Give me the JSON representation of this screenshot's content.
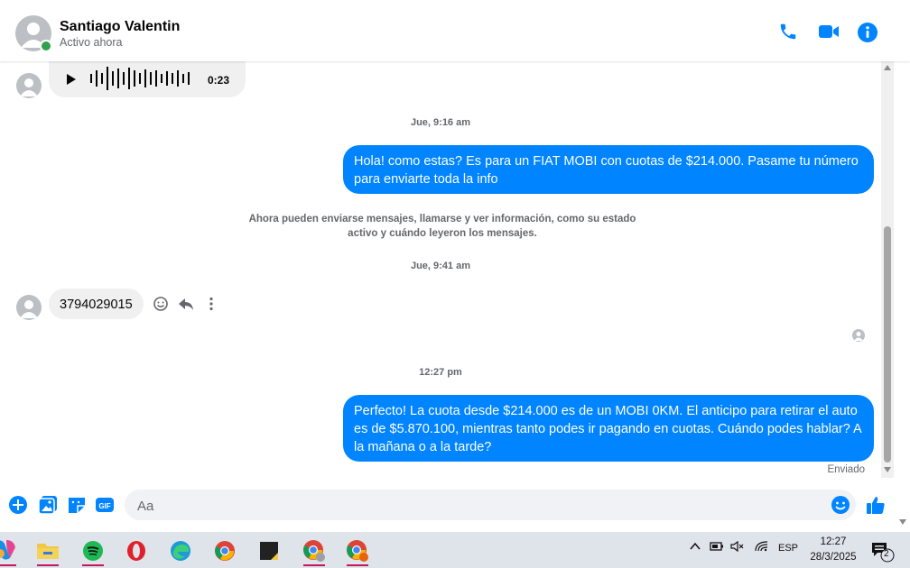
{
  "header": {
    "name": "Santiago Valentin",
    "status": "Activo ahora"
  },
  "messages": {
    "audio_duration": "0:23",
    "ts1": "Jue, 9:16 am",
    "out1": "Hola! como estas? Es para un FIAT MOBI con cuotas de $214.000. Pasame tu número para enviarte toda la info",
    "notice": "Ahora pueden enviarse mensajes, llamarse y ver información, como su estado activo y cuándo leyeron los mensajes.",
    "ts2": "Jue, 9:41 am",
    "in1": "3794029015",
    "ts3": "12:27 pm",
    "out2": "Perfecto! La cuota desde $214.000 es de un MOBI 0KM. El anticipo para retirar el auto es de $5.870.100, mientras tanto podes ir pagando en cuotas. Cuándo podes hablar? A la mañana o a la tarde?",
    "sent_status": "Enviado"
  },
  "composer": {
    "placeholder": "Aa"
  },
  "taskbar": {
    "language": "ESP",
    "time": "12:27",
    "date": "28/3/2025",
    "notifications": "2"
  },
  "colors": {
    "accent": "#0084ff",
    "online": "#31a24c",
    "incoming_bubble": "#f0f0f0"
  }
}
